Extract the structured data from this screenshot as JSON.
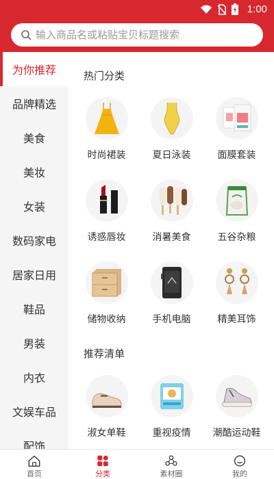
{
  "status_bar": {
    "time": "1:00"
  },
  "search": {
    "placeholder": "输入商品名或粘贴宝贝标题搜索"
  },
  "sidebar": {
    "items": [
      {
        "label": "为你推荐",
        "active": true
      },
      {
        "label": "品牌精选"
      },
      {
        "label": "美食"
      },
      {
        "label": "美妆"
      },
      {
        "label": "女装"
      },
      {
        "label": "数码家电"
      },
      {
        "label": "居家日用"
      },
      {
        "label": "鞋品"
      },
      {
        "label": "男装"
      },
      {
        "label": "内衣"
      },
      {
        "label": "文娱车品"
      },
      {
        "label": "配饰"
      }
    ]
  },
  "hot": {
    "title": "热门分类",
    "items": [
      {
        "label": "时尚裙装",
        "icon": "dress-icon"
      },
      {
        "label": "夏日泳装",
        "icon": "swimsuit-icon"
      },
      {
        "label": "面膜套装",
        "icon": "face-mask-icon"
      },
      {
        "label": "诱惑唇妆",
        "icon": "lipstick-icon"
      },
      {
        "label": "消暑美食",
        "icon": "popsicle-icon"
      },
      {
        "label": "五谷杂粮",
        "icon": "grain-bag-icon"
      },
      {
        "label": "储物收纳",
        "icon": "storage-box-icon"
      },
      {
        "label": "手机电脑",
        "icon": "phone-icon"
      },
      {
        "label": "精美耳饰",
        "icon": "earrings-icon"
      }
    ]
  },
  "recommend": {
    "title": "推荐清单",
    "items": [
      {
        "label": "淑女单鞋",
        "icon": "loafer-icon"
      },
      {
        "label": "重视疫情",
        "icon": "medical-mask-icon"
      },
      {
        "label": "潮酷运动鞋",
        "icon": "sneaker-icon"
      }
    ]
  },
  "bottom_nav": [
    {
      "label": "首页",
      "icon": "home-icon"
    },
    {
      "label": "分类",
      "icon": "category-icon",
      "active": true
    },
    {
      "label": "素材圈",
      "icon": "material-circle-icon"
    },
    {
      "label": "我的",
      "icon": "profile-icon"
    }
  ],
  "colors": {
    "brand": "#d7282f",
    "sidebar_bg": "#f5f5f5"
  }
}
